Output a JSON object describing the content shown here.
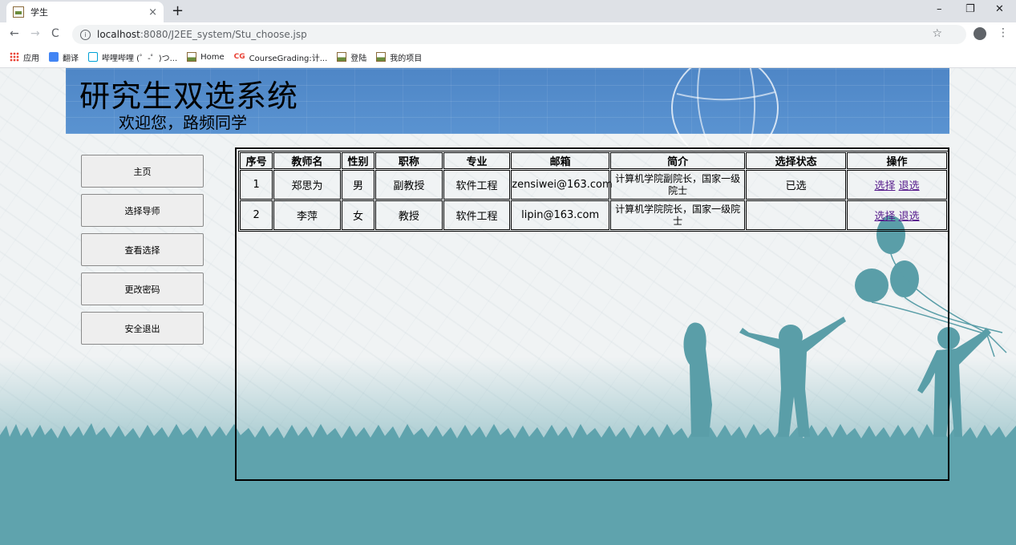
{
  "browser": {
    "tab_title": "学生",
    "tab_close": "×",
    "new_tab": "+",
    "window_controls": {
      "minimize": "–",
      "restore": "❐",
      "close": "✕"
    },
    "nav": {
      "back": "←",
      "forward": "→",
      "reload": "C"
    },
    "url_host": "localhost",
    "url_path": ":8080/J2EE_system/Stu_choose.jsp",
    "bookmarks": [
      "应用",
      "翻译",
      "哔哩哔哩 (゜-゜)つ...",
      "Home",
      "CourseGrading:计...",
      "登陆",
      "我的项目"
    ],
    "bookmark_cg_mark": "CG"
  },
  "header": {
    "title": "研究生双选系统",
    "welcome": "欢迎您，路频同学"
  },
  "sidebar": {
    "items": [
      "主页",
      "选择导师",
      "查看选择",
      "更改密码",
      "安全退出"
    ]
  },
  "table": {
    "headers": [
      "序号",
      "教师名",
      "性别",
      "职称",
      "专业",
      "邮箱",
      "简介",
      "选择状态",
      "操作"
    ],
    "rows": [
      {
        "no": "1",
        "name": "郑思为",
        "gender": "男",
        "title": "副教授",
        "major": "软件工程",
        "email": "zensiwei@163.com",
        "intro": "计算机学院副院长，国家一级院士",
        "status": "已选",
        "choose": "选择",
        "withdraw": "退选"
      },
      {
        "no": "2",
        "name": "李萍",
        "gender": "女",
        "title": "教授",
        "major": "软件工程",
        "email": "lipin@163.com",
        "intro": "计算机学院院长，国家一级院士",
        "status": "",
        "choose": "选择",
        "withdraw": "退选"
      }
    ]
  },
  "colors": {
    "banner": "#4e86c6",
    "ground": "#5fa3ad",
    "link": "#551a8b"
  }
}
